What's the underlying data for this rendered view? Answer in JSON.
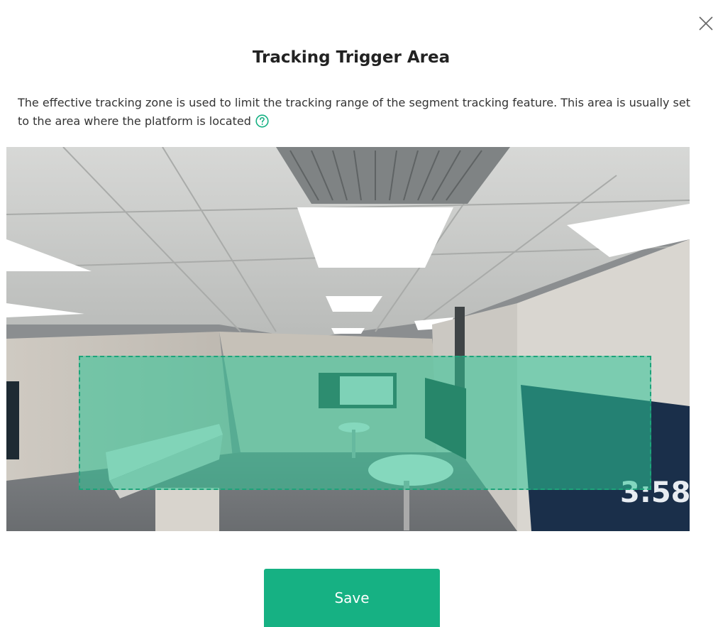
{
  "dialog": {
    "title": "Tracking Trigger Area",
    "description": "The effective tracking zone is used to limit the tracking range of the segment tracking feature. This area is usually set to the area where the platform is located",
    "help_icon": "question-circle-icon",
    "close_icon": "close-icon",
    "save_label": "Save"
  },
  "preview": {
    "clock_text": "3:58"
  },
  "colors": {
    "accent": "#16b183",
    "zone_fill": "#2ec496",
    "zone_border": "#1da47a"
  }
}
